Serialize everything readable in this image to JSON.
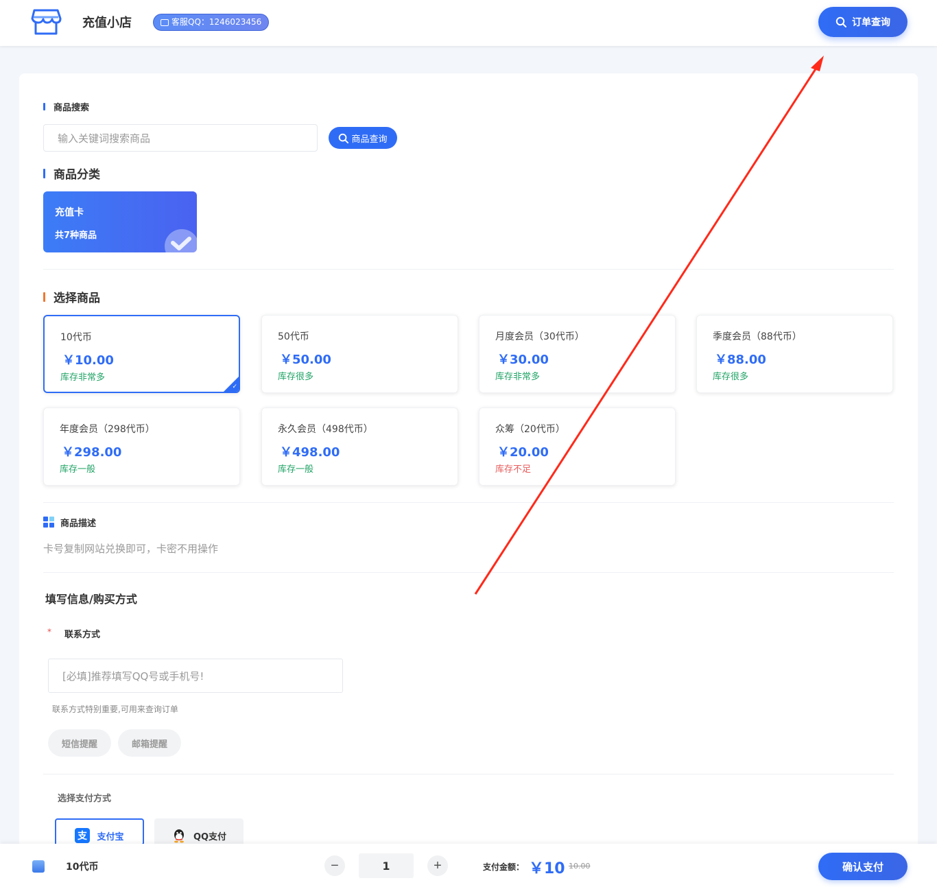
{
  "header": {
    "shop_name": "充值小店",
    "service_qq": "客服QQ：1246023456",
    "order_query_label": "订单查询"
  },
  "search": {
    "section_title": "商品搜索",
    "placeholder": "输入关键词搜索商品",
    "button_label": "商品查询"
  },
  "category": {
    "section_title": "商品分类",
    "items": [
      {
        "name": "充值卡",
        "count_text": "共7种商品",
        "selected": true
      }
    ]
  },
  "products": {
    "section_title": "选择商品",
    "items": [
      {
        "name": "10代币",
        "price": "￥10.00",
        "stock": "库存非常多",
        "stock_color": "#21a366",
        "selected": true
      },
      {
        "name": "50代币",
        "price": "￥50.00",
        "stock": "库存很多",
        "stock_color": "#21a366",
        "selected": false
      },
      {
        "name": "月度会员（30代币）",
        "price": "￥30.00",
        "stock": "库存非常多",
        "stock_color": "#21a366",
        "selected": false
      },
      {
        "name": "季度会员（88代币）",
        "price": "￥88.00",
        "stock": "库存很多",
        "stock_color": "#21a366",
        "selected": false
      },
      {
        "name": "年度会员（298代币）",
        "price": "￥298.00",
        "stock": "库存一般",
        "stock_color": "#21a366",
        "selected": false
      },
      {
        "name": "永久会员（498代币）",
        "price": "￥498.00",
        "stock": "库存一般",
        "stock_color": "#21a366",
        "selected": false
      },
      {
        "name": "众筹（20代币）",
        "price": "￥20.00",
        "stock": "库存不足",
        "stock_color": "#e85c5c",
        "selected": false
      }
    ]
  },
  "description": {
    "title": "商品描述",
    "text": "卡号复制网站兑换即可，卡密不用操作"
  },
  "form": {
    "title": "填写信息/购买方式",
    "required_mark": "*",
    "contact_label": "联系方式",
    "contact_placeholder": "[必填]推荐填写QQ号或手机号!",
    "contact_hint": "联系方式特别重要,可用来查询订单",
    "sms_label": "短信提醒",
    "email_label": "邮箱提醒"
  },
  "payment": {
    "title": "选择支付方式",
    "alipay_label": "支付宝",
    "qqpay_label": "QQ支付"
  },
  "footer": {
    "selected_product": "10代币",
    "quantity": "1",
    "pay_label": "支付金额：",
    "pay_amount": "￥10",
    "original_price": "10.00",
    "confirm_label": "确认支付",
    "minus_icon": "−",
    "plus_icon": "+"
  },
  "colors": {
    "accent": "#2f6cf6",
    "stock_ok": "#21a366",
    "stock_low": "#e85c5c",
    "annotation_arrow": "#ff2a1a"
  }
}
